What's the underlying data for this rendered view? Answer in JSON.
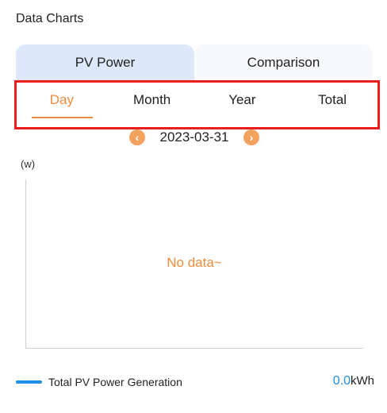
{
  "header": {
    "title": "Data Charts"
  },
  "mode_tabs": [
    {
      "label": "PV Power",
      "active": true
    },
    {
      "label": "Comparison",
      "active": false
    }
  ],
  "period_tabs": [
    {
      "label": "Day",
      "active": true
    },
    {
      "label": "Month",
      "active": false
    },
    {
      "label": "Year",
      "active": false
    },
    {
      "label": "Total",
      "active": false
    }
  ],
  "date_nav": {
    "date": "2023-03-31",
    "prev_icon": "chevron-left-icon",
    "next_icon": "chevron-right-icon"
  },
  "chart": {
    "y_unit": "(w)",
    "empty_message": "No data~"
  },
  "legend": {
    "label": "Total PV Power Generation",
    "value": "0.0",
    "unit": "kWh"
  },
  "colors": {
    "accent": "#f08a3c",
    "highlight_border": "#ee1d1d",
    "legend_blue": "#1e90e8",
    "active_tab_bg": "#dde9fb"
  }
}
